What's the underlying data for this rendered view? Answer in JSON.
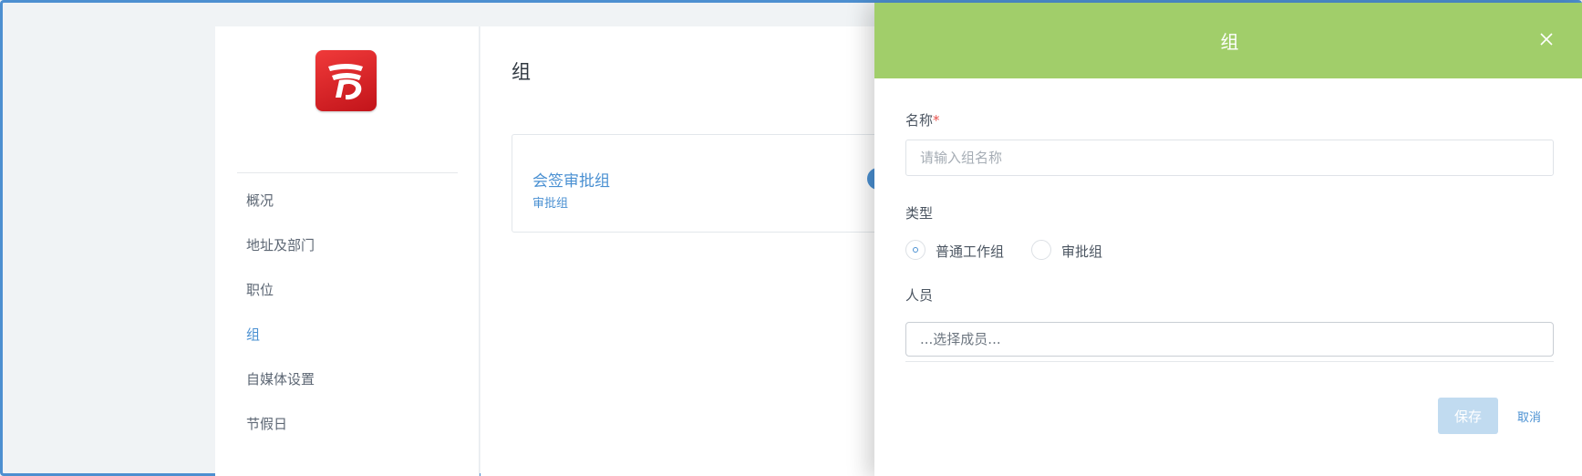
{
  "sidebar": {
    "logo_icon": "app-logo-icon",
    "items": [
      {
        "label": "概况"
      },
      {
        "label": "地址及部门"
      },
      {
        "label": "职位"
      },
      {
        "label": "组",
        "active": true
      },
      {
        "label": "自媒体设置"
      },
      {
        "label": "节假日"
      }
    ]
  },
  "main": {
    "title": "组",
    "group_card": {
      "name": "会签审批组",
      "type": "审批组"
    }
  },
  "drawer": {
    "title": "组",
    "close_icon": "close-icon",
    "header_color": "#a1ce6a",
    "name_field": {
      "label": "名称",
      "required_mark": "*",
      "value": "",
      "placeholder": "请输入组名称"
    },
    "type_field": {
      "label": "类型",
      "options": [
        {
          "label": "普通工作组",
          "checked": true
        },
        {
          "label": "审批组",
          "checked": false
        }
      ]
    },
    "members_field": {
      "label": "人员",
      "value": "",
      "placeholder": "...选择成员..."
    },
    "save_label": "保存",
    "cancel_label": "取消"
  },
  "colors": {
    "accent": "#4a90d2",
    "save_disabled": "#c1dbf0"
  }
}
